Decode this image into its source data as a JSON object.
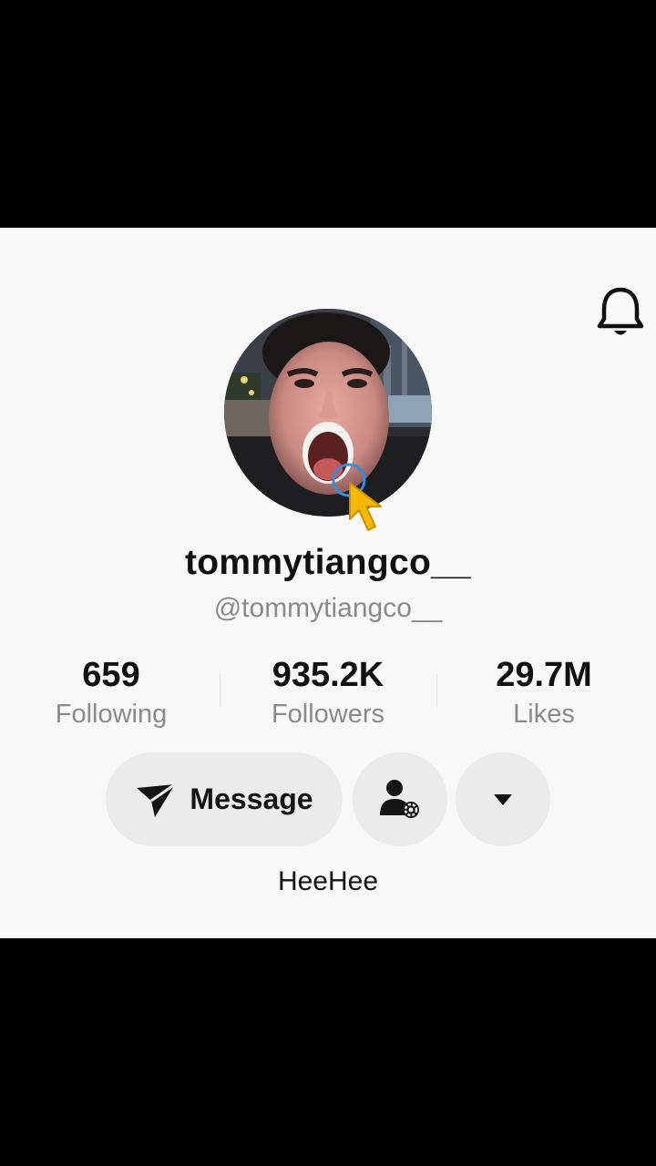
{
  "profile": {
    "display_name": "tommytiangco__",
    "handle": "@tommytiangco__",
    "bio": "HeeHee"
  },
  "stats": [
    {
      "value": "659",
      "label": "Following"
    },
    {
      "value": "935.2K",
      "label": "Followers"
    },
    {
      "value": "29.7M",
      "label": "Likes"
    }
  ],
  "actions": {
    "message_label": "Message",
    "message_icon": "paper-plane-icon",
    "follow_settings_icon": "user-settings-icon",
    "more_icon": "caret-down-icon"
  },
  "header": {
    "notification_icon": "bell-icon"
  },
  "colors": {
    "panel_background": "#f8f8f8",
    "button_background": "#ebebeb",
    "text_primary": "#111111",
    "text_secondary": "#8a8a8a",
    "cursor_accent": "#f5b800",
    "tap_ring": "#2f8fe0"
  }
}
